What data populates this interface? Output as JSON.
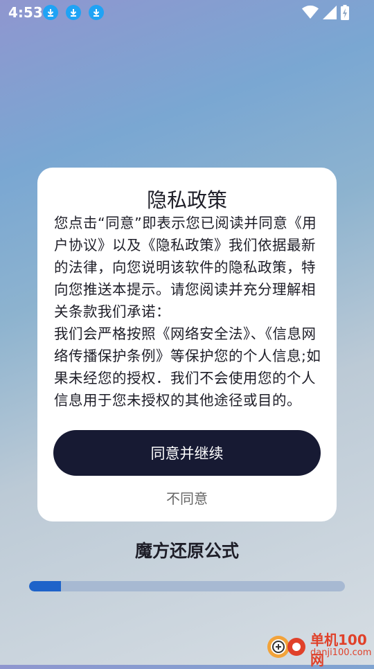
{
  "status_bar": {
    "time": "4:53",
    "notification_icons": [
      "download-icon",
      "download-icon",
      "download-icon"
    ],
    "system_icons": [
      "wifi-icon",
      "signal-icon",
      "battery-charging-icon"
    ]
  },
  "dialog": {
    "title": "隐私政策",
    "body": "您点击“同意”即表示您已阅读并同意《用户协议》以及《隐私政策》我们依据最新的法律，向您说明该软件的隐私政策，特向您推送本提示。请您阅读并充分理解相关条款我们承诺：\n我们会严格按照《网络安全法》、《信息网络传播保护条例》等保护您的个人信息;如果未经您的授权．我们不会使用您的个人信息用于您未授权的其他途径或目的。",
    "agree_button": "同意并继续",
    "disagree_link": "不同意"
  },
  "app": {
    "title": "魔方还原公式",
    "progress_percent": 10
  },
  "watermark": {
    "brand": "单机100网",
    "url": "danji100.com"
  },
  "colors": {
    "button_bg": "#171a33",
    "progress_fill": "#1e63c9",
    "progress_track": "#a7b9d2",
    "download_badge": "#1fa3f5"
  }
}
